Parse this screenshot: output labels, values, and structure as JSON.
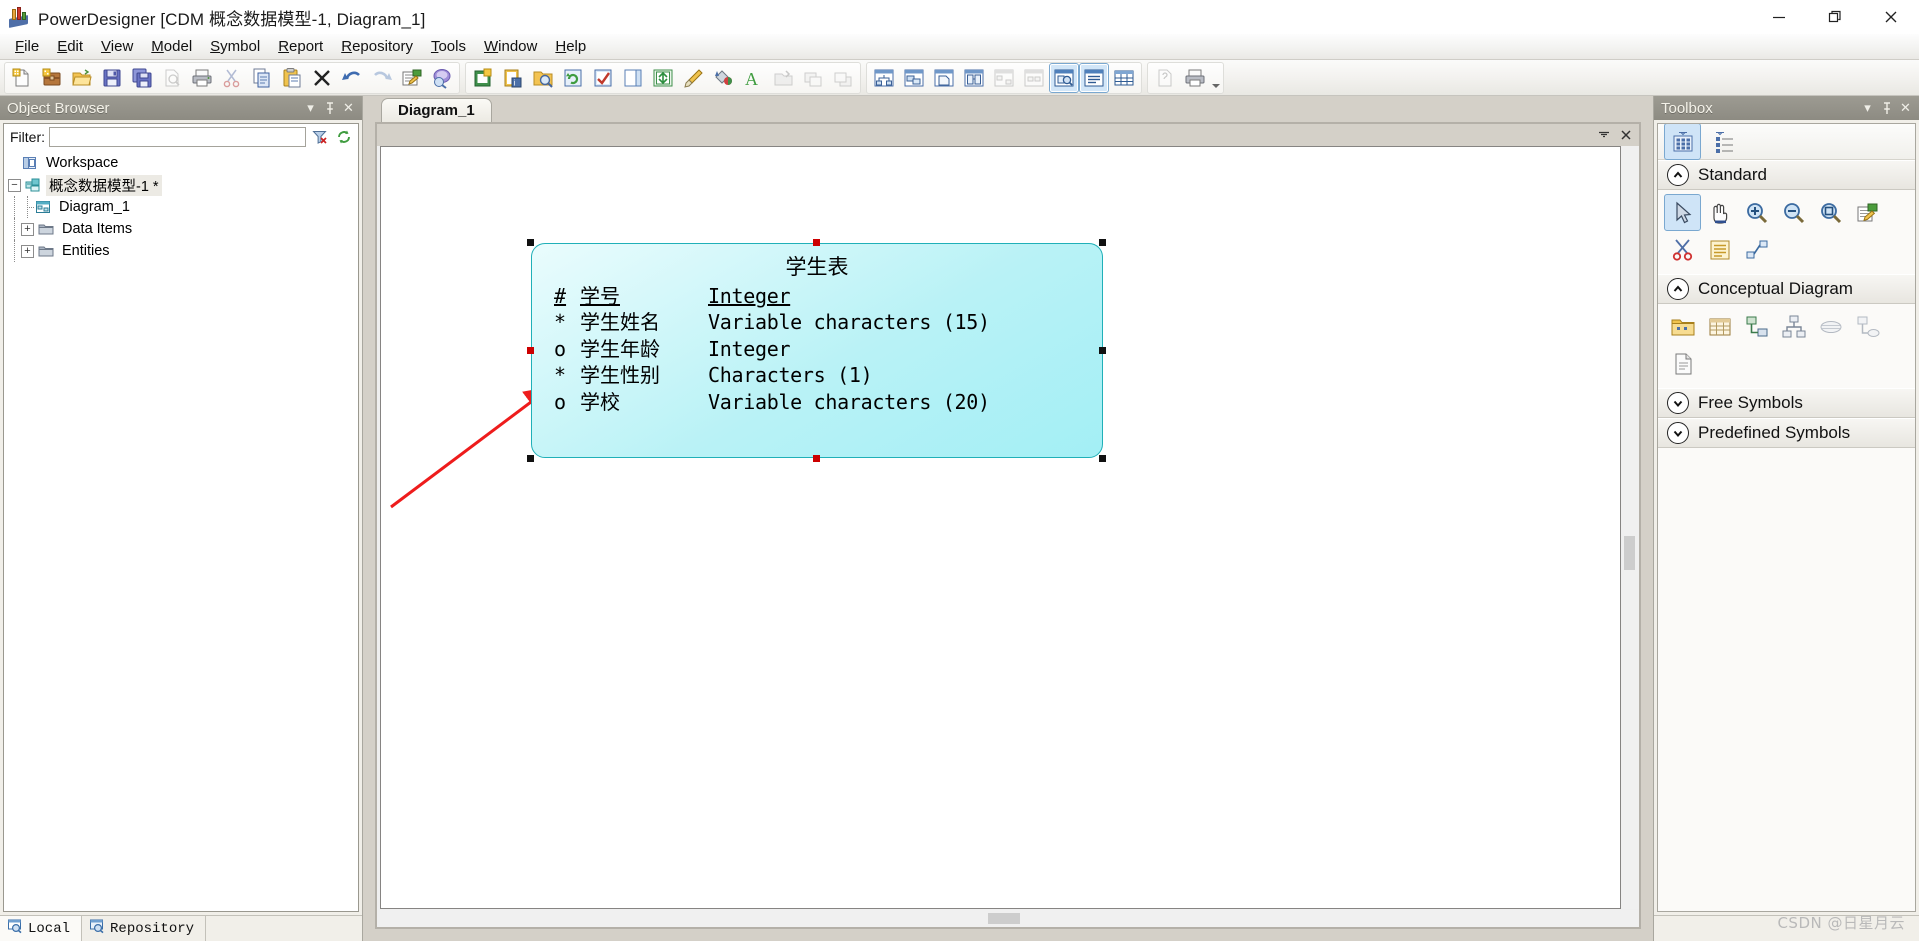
{
  "window": {
    "title": "PowerDesigner [CDM 概念数据模型-1, Diagram_1]",
    "app_icon": "powerdesigner-icon",
    "minimize_label": "Minimize",
    "restore_label": "Restore",
    "close_label": "Close"
  },
  "menubar": {
    "items": [
      {
        "label": "File",
        "mnemonic": "F"
      },
      {
        "label": "Edit",
        "mnemonic": "E"
      },
      {
        "label": "View",
        "mnemonic": "V"
      },
      {
        "label": "Model",
        "mnemonic": "M"
      },
      {
        "label": "Symbol",
        "mnemonic": "S"
      },
      {
        "label": "Report",
        "mnemonic": "R"
      },
      {
        "label": "Repository",
        "mnemonic": "R"
      },
      {
        "label": "Tools",
        "mnemonic": "T"
      },
      {
        "label": "Window",
        "mnemonic": "W"
      },
      {
        "label": "Help",
        "mnemonic": "H"
      }
    ]
  },
  "toolbar": {
    "groups": [
      {
        "name": "file-group",
        "buttons": [
          {
            "icon": "new-model-icon",
            "label": "New Model"
          },
          {
            "icon": "new-project-icon",
            "label": "New Project"
          },
          {
            "icon": "open-model-icon",
            "label": "Open Model"
          },
          {
            "icon": "save-icon",
            "label": "Save"
          },
          {
            "icon": "save-all-icon",
            "label": "Save All"
          },
          {
            "icon": "print-preview-icon",
            "label": "Print Preview",
            "disabled": true
          },
          {
            "icon": "print-icon",
            "label": "Print"
          },
          {
            "icon": "cut-icon",
            "label": "Cut",
            "disabled": true
          },
          {
            "icon": "copy-icon",
            "label": "Copy"
          },
          {
            "icon": "paste-icon",
            "label": "Paste"
          },
          {
            "icon": "delete-icon",
            "label": "Delete"
          },
          {
            "icon": "undo-icon",
            "label": "Undo"
          },
          {
            "icon": "redo-icon",
            "label": "Redo",
            "disabled": true
          },
          {
            "icon": "properties-icon",
            "label": "Properties"
          },
          {
            "icon": "find-icon",
            "label": "Find"
          }
        ]
      },
      {
        "name": "model-group",
        "buttons": [
          {
            "icon": "new-diagram-icon",
            "label": "New Diagram"
          },
          {
            "icon": "model-options-icon",
            "label": "Model Options"
          },
          {
            "icon": "browse-icon",
            "label": "Browse"
          },
          {
            "icon": "refresh-icon",
            "label": "Refresh"
          },
          {
            "icon": "check-model-icon",
            "label": "Check Model"
          },
          {
            "icon": "page-icon",
            "label": "Page"
          },
          {
            "icon": "auto-layout-icon",
            "label": "Auto Layout"
          },
          {
            "icon": "format-brush-icon",
            "label": "Format Brush"
          },
          {
            "icon": "fill-color-icon",
            "label": "Fill Color"
          },
          {
            "icon": "font-color-icon",
            "label": "Font"
          },
          {
            "icon": "export-icon",
            "label": "Export",
            "disabled": true
          },
          {
            "icon": "send-to-back-icon",
            "label": "Send To Back",
            "disabled": true
          },
          {
            "icon": "bring-to-front-icon",
            "label": "Bring To Front",
            "disabled": true
          }
        ]
      },
      {
        "name": "view-group",
        "buttons": [
          {
            "icon": "dependency-view-icon",
            "label": "Dependency Matrix"
          },
          {
            "icon": "mapping-view-icon",
            "label": "Mapping Editor"
          },
          {
            "icon": "page-view-icon",
            "label": "Page View"
          },
          {
            "icon": "merge-view-icon",
            "label": "Merge Models"
          },
          {
            "icon": "compare-models-icon",
            "label": "Compare Models",
            "disabled": true
          },
          {
            "icon": "impact-analysis-icon",
            "label": "Impact Analysis",
            "disabled": true
          },
          {
            "icon": "object-browser-toggle-icon",
            "label": "Object Browser",
            "active": true
          },
          {
            "icon": "result-list-toggle-icon",
            "label": "Result List",
            "active": true
          },
          {
            "icon": "grid-view-icon",
            "label": "Grid View"
          }
        ]
      },
      {
        "name": "help-group",
        "buttons": [
          {
            "icon": "help-pointer-icon",
            "label": "Context Help",
            "disabled": true
          },
          {
            "icon": "print-setup-icon",
            "label": "Print Setup"
          }
        ]
      }
    ]
  },
  "object_browser": {
    "title": "Object Browser",
    "menu_btn": "panel-menu",
    "pin_btn": "panel-pin",
    "close_btn": "panel-close",
    "filter_label": "Filter:",
    "filter_value": "",
    "filter_placeholder": "",
    "filter_clear_icon": "filter-clear-icon",
    "filter_refresh_icon": "refresh-icon",
    "tree": [
      {
        "label": "Workspace",
        "icon": "workspace-icon",
        "level": 0,
        "expander": "",
        "selected": false
      },
      {
        "label": "概念数据模型-1 *",
        "icon": "cdm-model-icon",
        "level": 1,
        "expander": "-",
        "selected": true
      },
      {
        "label": "Diagram_1",
        "icon": "diagram-icon",
        "level": 2,
        "expander": "",
        "selected": false
      },
      {
        "label": "Data Items",
        "icon": "folder-icon",
        "level": 2,
        "expander": "+",
        "selected": false
      },
      {
        "label": "Entities",
        "icon": "folder-icon",
        "level": 2,
        "expander": "+",
        "selected": false
      }
    ],
    "status_tabs": [
      {
        "label": "Local",
        "icon": "local-icon",
        "active": true
      },
      {
        "label": "Repository",
        "icon": "repository-icon",
        "active": false
      }
    ]
  },
  "document": {
    "tabs": [
      {
        "label": "Diagram_1",
        "active": true
      }
    ],
    "mdi_buttons": [
      {
        "name": "mdi-restore-button",
        "glyph": "▾"
      },
      {
        "name": "mdi-close-button",
        "glyph": "✕"
      }
    ]
  },
  "diagram": {
    "entity": {
      "name": "学生表",
      "attributes": [
        {
          "marker": "#",
          "name": "学号",
          "type": "Integer",
          "primary": true
        },
        {
          "marker": "*",
          "name": "学生姓名",
          "type": "Variable characters (15)",
          "primary": false
        },
        {
          "marker": "o",
          "name": "学生年龄",
          "type": "Integer",
          "primary": false
        },
        {
          "marker": "*",
          "name": "学生性别",
          "type": "Characters (1)",
          "primary": false
        },
        {
          "marker": "o",
          "name": "学校",
          "type": "Variable characters (20)",
          "primary": false
        }
      ],
      "selected": true,
      "fill_color": "#a9f0f5",
      "border_color": "#20b0b8"
    },
    "annotation_arrow": {
      "color": "#ee1c1c",
      "name": "red-pointer-arrow"
    }
  },
  "toolbox": {
    "title": "Toolbox",
    "menu_btn": "panel-menu",
    "pin_btn": "panel-pin",
    "close_btn": "panel-close",
    "top_buttons": [
      {
        "icon": "toolbox-grid-view-icon",
        "label": "Grid View",
        "active": true
      },
      {
        "icon": "toolbox-list-view-icon",
        "label": "List View",
        "active": false
      }
    ],
    "sections": [
      {
        "label": "Standard",
        "expanded": true,
        "items": [
          {
            "icon": "pointer-icon",
            "label": "Pointer",
            "active": true
          },
          {
            "icon": "grabber-hand-icon",
            "label": "Grabber"
          },
          {
            "icon": "zoom-in-icon",
            "label": "Zoom In"
          },
          {
            "icon": "zoom-out-icon",
            "label": "Zoom Out"
          },
          {
            "icon": "zoom-fit-icon",
            "label": "Zoom to Fit"
          },
          {
            "icon": "properties-icon",
            "label": "Properties"
          },
          {
            "icon": "delete-scissors-icon",
            "label": "Delete"
          },
          {
            "icon": "note-icon",
            "label": "Note"
          },
          {
            "icon": "link-icon",
            "label": "Link"
          }
        ]
      },
      {
        "label": "Conceptual Diagram",
        "expanded": true,
        "items": [
          {
            "icon": "package-icon",
            "label": "Package"
          },
          {
            "icon": "entity-icon",
            "label": "Entity"
          },
          {
            "icon": "relationship-icon",
            "label": "Relationship"
          },
          {
            "icon": "inheritance-icon",
            "label": "Inheritance"
          },
          {
            "icon": "association-icon",
            "label": "Association",
            "disabled": true
          },
          {
            "icon": "association-link-icon",
            "label": "Association Link",
            "disabled": true
          },
          {
            "icon": "file-object-icon",
            "label": "File"
          }
        ]
      },
      {
        "label": "Free Symbols",
        "expanded": false,
        "items": []
      },
      {
        "label": "Predefined Symbols",
        "expanded": false,
        "items": []
      }
    ]
  },
  "watermark": {
    "text": "CSDN @日星月云"
  }
}
